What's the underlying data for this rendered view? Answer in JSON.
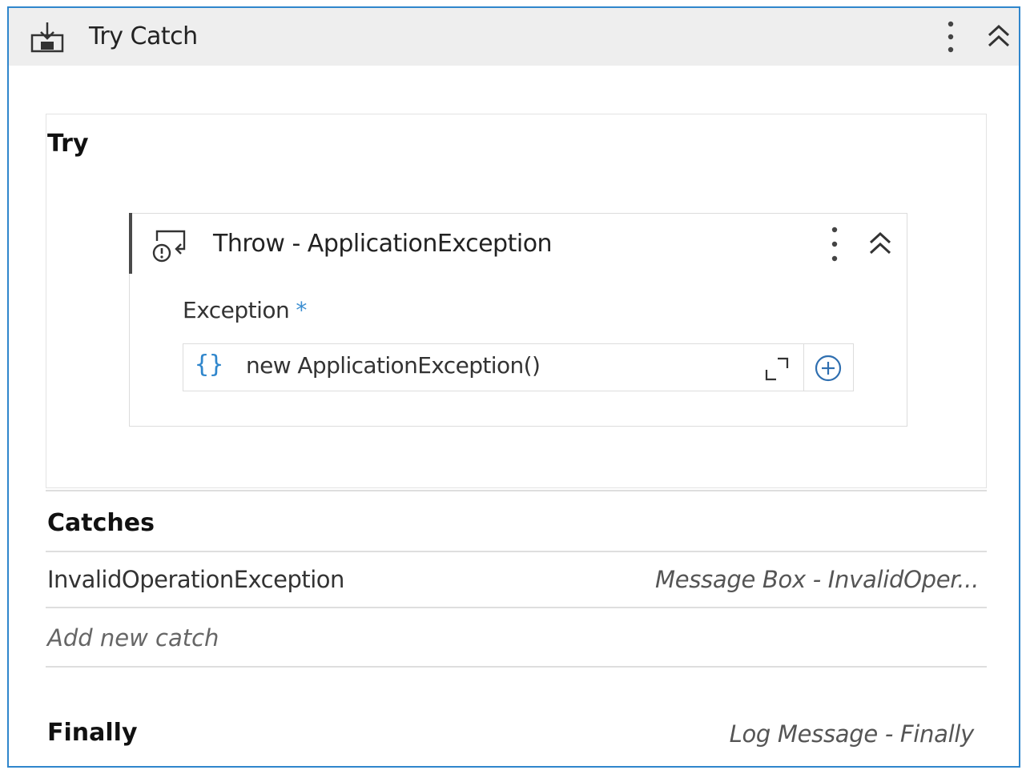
{
  "activity": {
    "title": "Try Catch",
    "icon": "try-catch-icon"
  },
  "try": {
    "label": "Try",
    "throw": {
      "title": "Throw - ApplicationException",
      "icon": "throw-icon",
      "exception_label": "Exception",
      "required_marker": "*",
      "value_prefix": "{}",
      "value": "new ApplicationException()"
    }
  },
  "catches": {
    "label": "Catches",
    "items": [
      {
        "exception_type": "InvalidOperationException",
        "action": "Message Box - InvalidOper..."
      }
    ],
    "add_label": "Add new catch"
  },
  "finally": {
    "label": "Finally",
    "action": "Log Message - Finally"
  },
  "colors": {
    "accent": "#2f86cc",
    "header_bg": "#eeeeee"
  }
}
